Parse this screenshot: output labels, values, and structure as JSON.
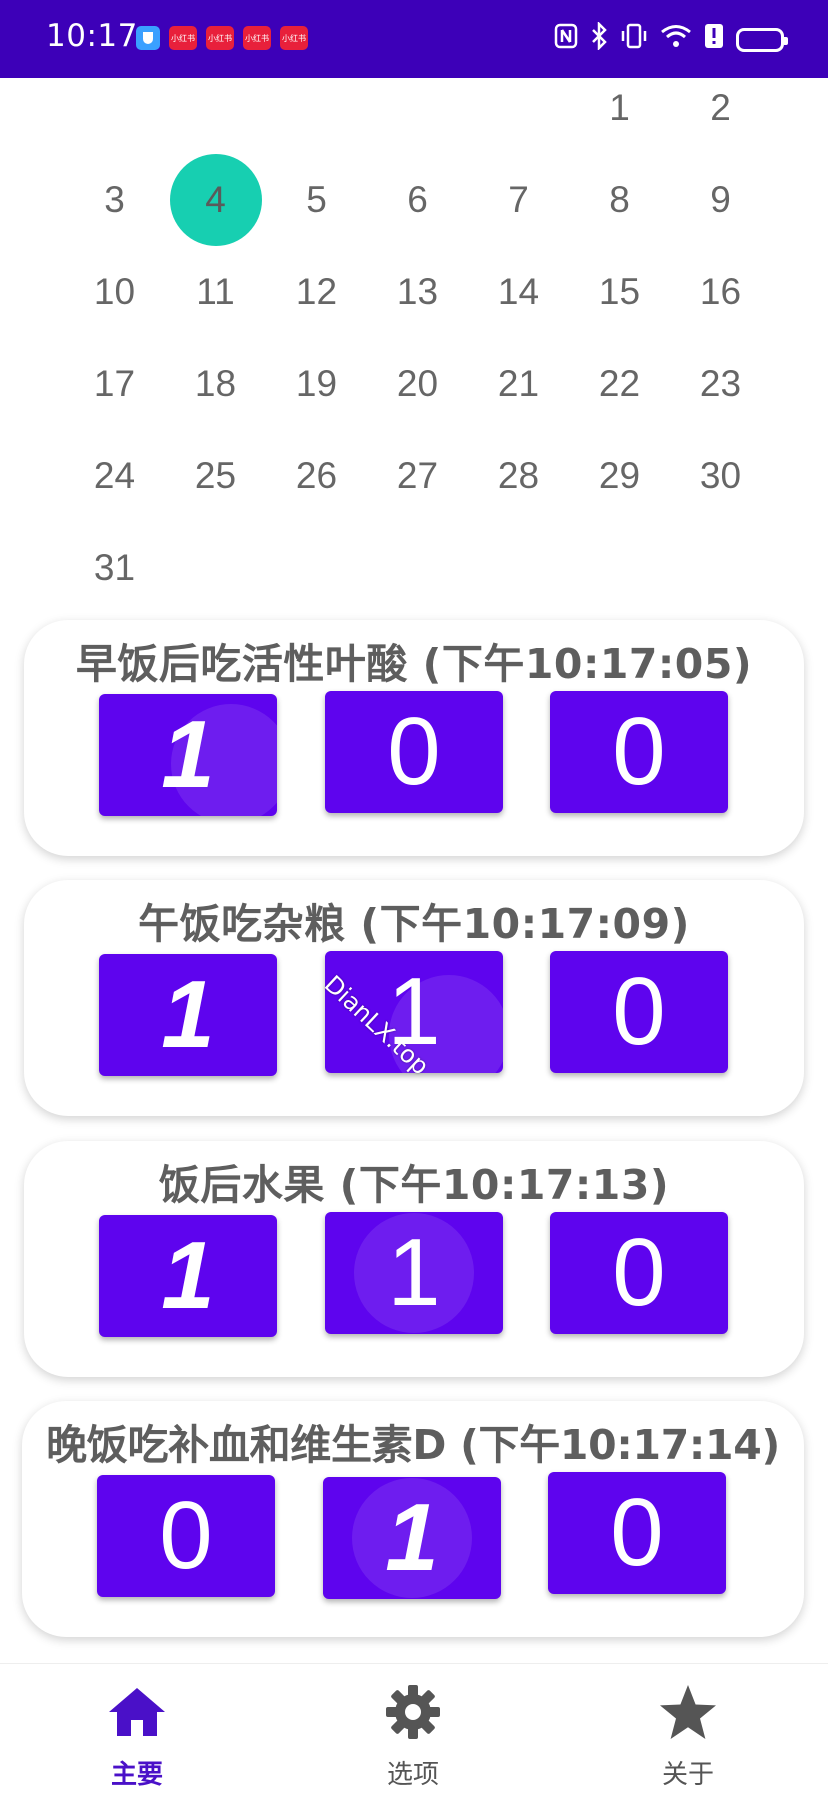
{
  "status_bar": {
    "time": "10:17",
    "app_badges": [
      "小红书",
      "小红书",
      "小红书",
      "小红书"
    ]
  },
  "calendar": {
    "leading_blanks": 5,
    "days": [
      "1",
      "2",
      "3",
      "4",
      "5",
      "6",
      "7",
      "8",
      "9",
      "10",
      "11",
      "12",
      "13",
      "14",
      "15",
      "16",
      "17",
      "18",
      "19",
      "20",
      "21",
      "22",
      "23",
      "24",
      "25",
      "26",
      "27",
      "28",
      "29",
      "30",
      "31"
    ],
    "selected_day": "4",
    "selected_color": "#17cfb1"
  },
  "cards": [
    {
      "title": "早饭后吃活性叶酸 (下午10:17:05)",
      "counters": [
        "1",
        "0",
        "0"
      ]
    },
    {
      "title": "午饭吃杂粮 (下午10:17:09)",
      "counters": [
        "1",
        "1",
        "0"
      ]
    },
    {
      "title": "饭后水果 (下午10:17:13)",
      "counters": [
        "1",
        "1",
        "0"
      ]
    },
    {
      "title": "晚饭吃补血和维生素D (下午10:17:14)",
      "counters": [
        "0",
        "1",
        "0"
      ]
    }
  ],
  "watermark": "DianLX.top",
  "bottom_nav": {
    "items": [
      {
        "label": "主要",
        "icon": "home-icon",
        "active": true
      },
      {
        "label": "选项",
        "icon": "gear-icon",
        "active": false
      },
      {
        "label": "关于",
        "icon": "star-icon",
        "active": false
      }
    ]
  },
  "colors": {
    "primary": "#3d00b8",
    "counter_bg": "#5e04ee",
    "accent": "#17cfb1"
  }
}
